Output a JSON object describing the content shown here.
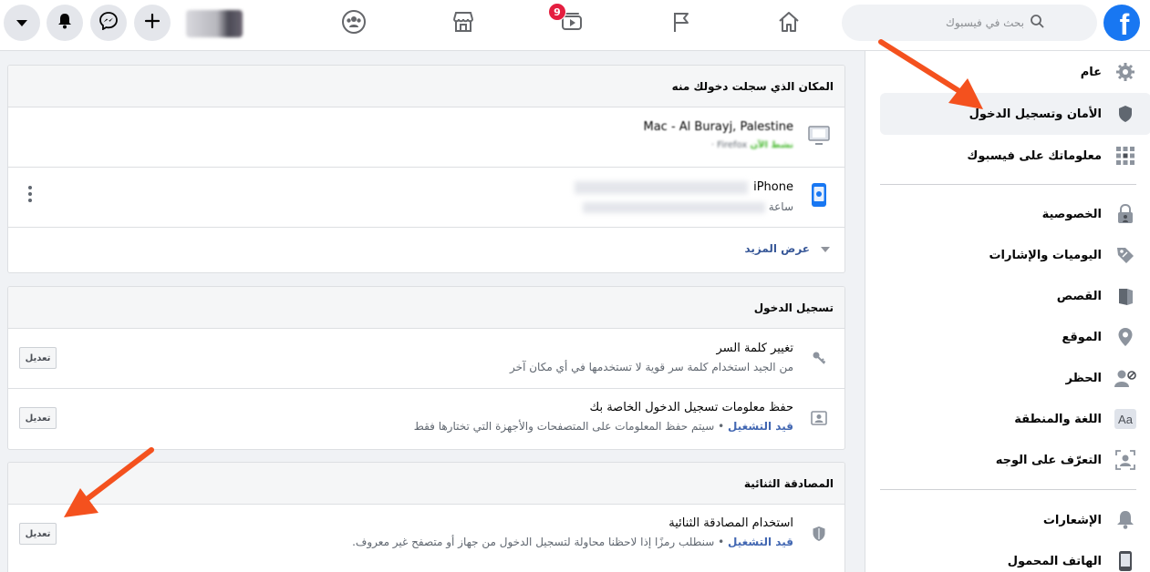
{
  "colors": {
    "brand": "#1877f2",
    "badge": "#e41e3f",
    "status_on": "#4267b2",
    "online": "#42b72a",
    "arrow": "#f4511e"
  },
  "header": {
    "search_placeholder": "بحث في فيسبوك",
    "logo": "f",
    "watch_badge": "9",
    "icons": [
      "caret-down-icon",
      "notifications-icon",
      "messenger-icon",
      "create-icon",
      "groups-icon",
      "marketplace-icon",
      "watch-icon",
      "pages-flag-icon",
      "home-icon",
      "search-icon"
    ]
  },
  "sidebar": {
    "items": [
      {
        "label": "عام",
        "icon": "gear-icon"
      },
      {
        "label": "الأمان وتسجيل الدخول",
        "icon": "shield-icon",
        "active": true
      },
      {
        "label": "معلوماتك على فيسبوك",
        "icon": "grid-icon"
      },
      {
        "label": "الخصوصية",
        "icon": "lock-icon"
      },
      {
        "label": "اليوميات والإشارات",
        "icon": "tag-icon"
      },
      {
        "label": "القصص",
        "icon": "book-icon"
      },
      {
        "label": "الموقع",
        "icon": "location-pin-icon"
      },
      {
        "label": "الحظر",
        "icon": "block-user-icon"
      },
      {
        "label": "اللغة والمنطقة",
        "icon": "language-aa-icon"
      },
      {
        "label": "التعرّف على الوجه",
        "icon": "face-recognition-icon"
      },
      {
        "label": "الإشعارات",
        "icon": "bell-icon"
      },
      {
        "label": "الهاتف المحمول",
        "icon": "mobile-phone-icon"
      }
    ]
  },
  "where_logged_in": {
    "title": "المكان الذي سجلت دخولك منه",
    "sessions": [
      {
        "device": "Mac - Al Burayj, Palestine",
        "active_label": "نشط الآن",
        "detail": "Firefox ·"
      },
      {
        "device": "iPhone",
        "detail": "ساعة"
      }
    ],
    "see_more": "عرض المزيد"
  },
  "login": {
    "title": "تسجيل الدخول",
    "rows": [
      {
        "title": "تغيير كلمة السر",
        "subtitle": "من الجيد استخدام كلمة سر قوية لا تستخدمها في أي مكان آخر",
        "edit": "تعديل"
      },
      {
        "title": "حفظ معلومات تسجيل الدخول الخاصة بك",
        "status": "قيد التشغيل",
        "subtitle": "سيتم حفظ المعلومات على المتصفحات والأجهزة التي تختارها فقط",
        "edit": "تعديل"
      }
    ]
  },
  "two_factor": {
    "title": "المصادقة الثنائية",
    "rows": [
      {
        "title": "استخدام المصادقة الثنائية",
        "status": "قيد التشغيل",
        "subtitle": "سنطلب رمزًا إذا لاحظنا محاولة لتسجيل الدخول من جهاز أو متصفح غير معروف.",
        "edit": "تعديل"
      }
    ]
  }
}
